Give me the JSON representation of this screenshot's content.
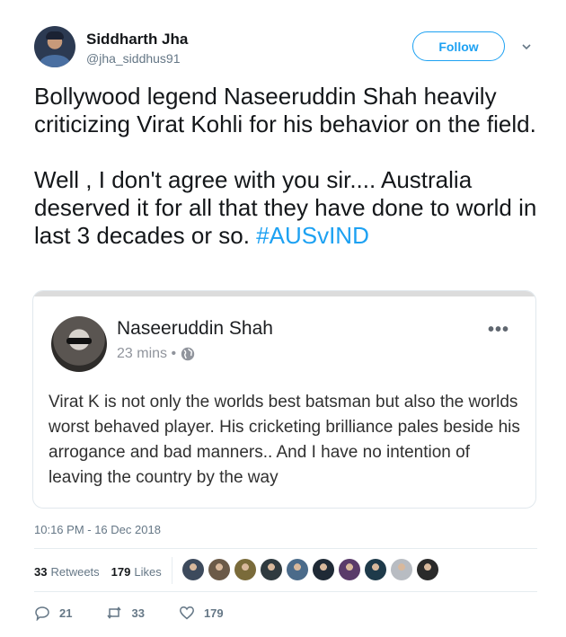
{
  "author": {
    "name": "Siddharth Jha",
    "handle": "@jha_siddhus91"
  },
  "follow_label": "Follow",
  "tweet": {
    "paragraph1": "Bollywood legend Naseeruddin Shah heavily criticizing Virat Kohli for his behavior on the field.",
    "paragraph2": "Well , I don't agree with you sir.... Australia deserved it for all that they have done to world in last 3 decades or so.",
    "hashtag": "#AUSvIND"
  },
  "embedded_post": {
    "name": "Naseeruddin Shah",
    "time": "23 mins •",
    "text": "Virat K is not only the worlds best batsman but also the worlds worst behaved player. His cricketing brilliance pales beside his arrogance and bad manners.. And I have no intention of leaving the country by the way"
  },
  "timestamp": "10:16 PM - 16 Dec 2018",
  "stats": {
    "retweets_count": "33",
    "retweets_label": "Retweets",
    "likes_count": "179",
    "likes_label": "Likes"
  },
  "likers": [
    "#3d4a5c",
    "#6b5a48",
    "#7a6b3a",
    "#2f3a3f",
    "#4b6b8a",
    "#1f2a36",
    "#5a3b6a",
    "#1e3a4a",
    "#b8bcc2",
    "#2a2a2a"
  ],
  "actions": {
    "replies": "21",
    "retweets": "33",
    "likes": "179"
  },
  "colors": {
    "accent": "#1da1f2",
    "secondary_text": "#657786"
  }
}
